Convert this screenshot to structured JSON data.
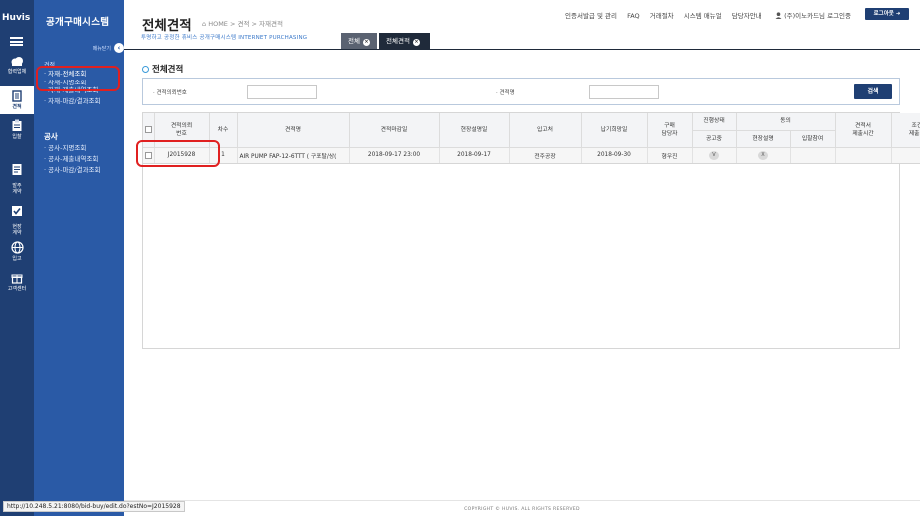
{
  "rail": {
    "logo": "Huvis",
    "items": [
      {
        "label": "협력업체",
        "icon": "cloud-icon"
      },
      {
        "label": "견적",
        "icon": "document-icon"
      },
      {
        "label": "입찰",
        "icon": "clipboard-icon"
      },
      {
        "label": "발주\n계약",
        "icon": "contract-icon"
      },
      {
        "label": "현장\n계약",
        "icon": "check-icon"
      },
      {
        "label": "입고",
        "icon": "globe-icon"
      },
      {
        "label": "고객센터",
        "icon": "gift-icon"
      }
    ]
  },
  "sidebar": {
    "title": "공개구매시스템",
    "collapse_label": "메뉴닫기",
    "group1": "견적",
    "group1_items": [
      "· 자재-전체조회",
      "· 자재-지명조회",
      "· 자재-제출내역조회",
      "· 자재-마감/결과조회"
    ],
    "group2": "공사",
    "group2_items": [
      "· 공사-지명조회",
      "· 공사-제출내역조회",
      "· 공사-마감/결과조회"
    ]
  },
  "header": {
    "title": "전체견적",
    "breadcrumb": "⌂ HOME > 견적 > 자재견적",
    "subtitle": "투명하고 공정한 휴비스 공개구매시스템  INTERNET PURCHASING",
    "links": [
      "인증서발급 및 관리",
      "FAQ",
      "거래절차",
      "시스템 매뉴얼",
      "담당자안내"
    ],
    "user": "(주)이노카드님 로그인중",
    "logout": "로그아웃 ➜"
  },
  "tabs": [
    {
      "label": "전체",
      "bg": "#5a6271"
    },
    {
      "label": "전체견적",
      "bg": "#1f2a3a"
    }
  ],
  "section_title": "전체견적",
  "search": {
    "field1_label": "· 견적의뢰번호",
    "field1_value": "",
    "field2_label": "· 견적명",
    "field2_value": "",
    "button": "검색"
  },
  "table": {
    "headers": {
      "request_no": "견적의뢰\n번호",
      "round": "차수",
      "name": "견적명",
      "deadline": "견적마감일",
      "site_briefing": "현장설명일",
      "warehouse": "입고처",
      "delivery": "납기희망일",
      "buyer": "구매\n담당자",
      "status": "진행상태",
      "announce": "공고중",
      "agree": "동의",
      "site_desc": "현장설명",
      "bid_join": "입찰참여",
      "estimate_submit": "견적서\n제출시간",
      "terms_submit": "조건표\n제출시간"
    },
    "rows": [
      {
        "request_no": "J2015928",
        "round": "1",
        "name": "AIR PUMP  FAP-12-6TTT ( 구포탈/상(",
        "deadline": "2018-09-17 23:00",
        "site_briefing": "2018-09-17",
        "warehouse": "전주공장",
        "delivery": "2018-09-30",
        "buyer": "형우진",
        "announce": "V",
        "site_desc": "X",
        "bid_join": "",
        "estimate_submit": "",
        "terms_submit": ""
      }
    ]
  },
  "statusbar": "http://10.248.5.21:8080/bid-buy/edit.do?estNo=J2015928",
  "footer": "COPYRIGHT © HUVIS. ALL RIGHTS RESERVED"
}
